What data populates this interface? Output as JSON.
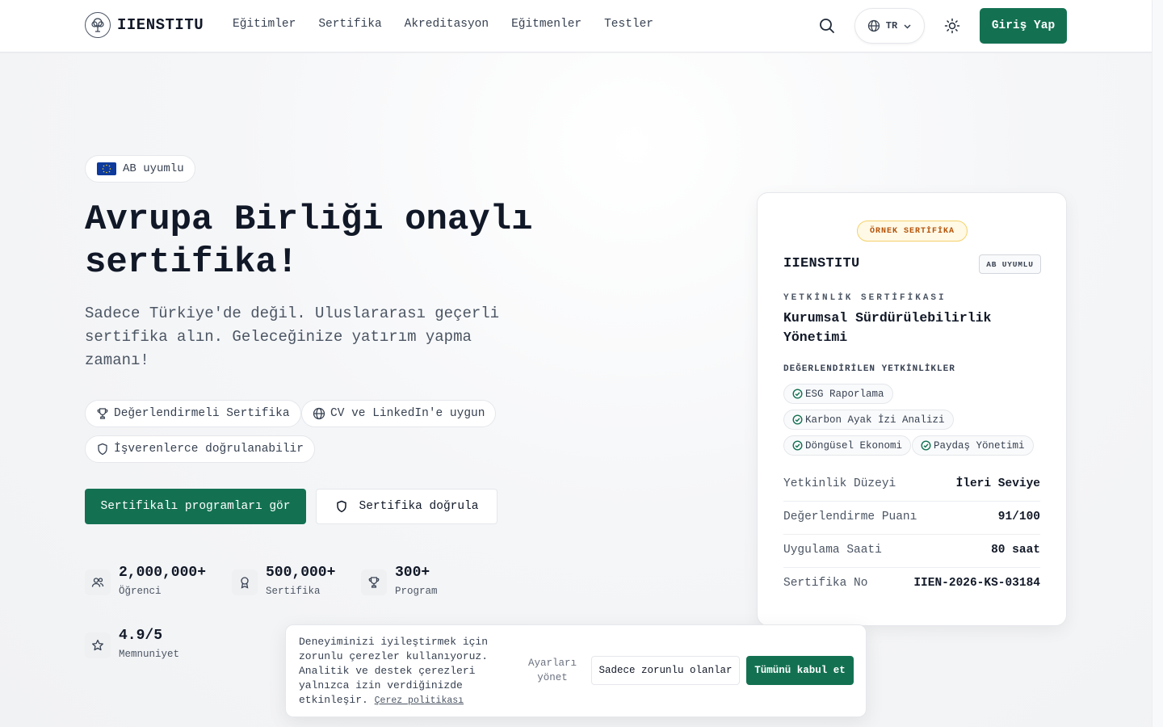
{
  "colors": {
    "brand_green": "#137152",
    "eu_blue": "#0d3a9c",
    "sample_badge_text": "#b45309",
    "sample_badge_border": "#f5d26b",
    "check_green": "#137152"
  },
  "header": {
    "logo_text": "IIENSTITU",
    "nav": [
      "Eğitimler",
      "Sertifika",
      "Akreditasyon",
      "Eğitmenler",
      "Testler"
    ],
    "language": "TR",
    "login_label": "Giriş Yap",
    "icons": [
      "tree-logo-icon",
      "search-icon",
      "globe-icon",
      "chevron-down-icon",
      "sun-icon"
    ]
  },
  "hero": {
    "badge": "AB uyumlu",
    "title": "Avrupa Birliği onaylı sertifika!",
    "subtitle": "Sadece Türkiye'de değil. Uluslararası geçerli sertifika alın. Geleceğinize yatırım yapma zamanı!",
    "features": [
      {
        "label": "Değerlendirmeli Sertifika",
        "icon": "trophy-icon"
      },
      {
        "label": "CV ve LinkedIn'e uygun",
        "icon": "globe-icon"
      },
      {
        "label": "İşverenlerce doğrulanabilir",
        "icon": "shield-icon"
      }
    ],
    "primary_cta": "Sertifikalı programları gör",
    "secondary_cta": "Sertifika doğrula",
    "stats": [
      {
        "value": "2,000,000+",
        "label": "Öğrenci",
        "icon": "users-icon"
      },
      {
        "value": "500,000+",
        "label": "Sertifika",
        "icon": "award-icon"
      },
      {
        "value": "300+",
        "label": "Program",
        "icon": "trophy-icon"
      },
      {
        "value": "4.9/5",
        "label": "Memnuniyet",
        "icon": "star-icon"
      }
    ]
  },
  "certificate": {
    "sample_badge": "ÖRNEK SERTİFİKA",
    "brand": "IIENSTITU",
    "eu_tag": "AB UYUMLU",
    "kind": "YETKİNLİK SERTİFİKASI",
    "name": "Kurumsal Sürdürülebilirlik Yönetimi",
    "competencies_title": "DEĞERLENDİRİLEN YETKİNLİKLER",
    "competencies": [
      "ESG Raporlama",
      "Karbon Ayak İzi Analizi",
      "Döngüsel Ekonomi",
      "Paydaş Yönetimi"
    ],
    "rows": [
      {
        "label": "Yetkinlik Düzeyi",
        "value": "İleri Seviye"
      },
      {
        "label": "Değerlendirme Puanı",
        "value": "91/100"
      },
      {
        "label": "Uygulama Saati",
        "value": "80 saat"
      },
      {
        "label": "Sertifika No",
        "value": "IIEN-2026-KS-03184"
      }
    ]
  },
  "cookie": {
    "text": "Deneyiminizi iyileştirmek için zorunlu çerezler kullanıyoruz. Analitik ve destek çerezleri yalnızca izin verdiğinizde etkinleşir.",
    "policy_link": "Çerez politikası",
    "manage_label": "Ayarları yönet",
    "necessary_label": "Sadece zorunlu olanlar",
    "accept_label": "Tümünü kabul et"
  }
}
